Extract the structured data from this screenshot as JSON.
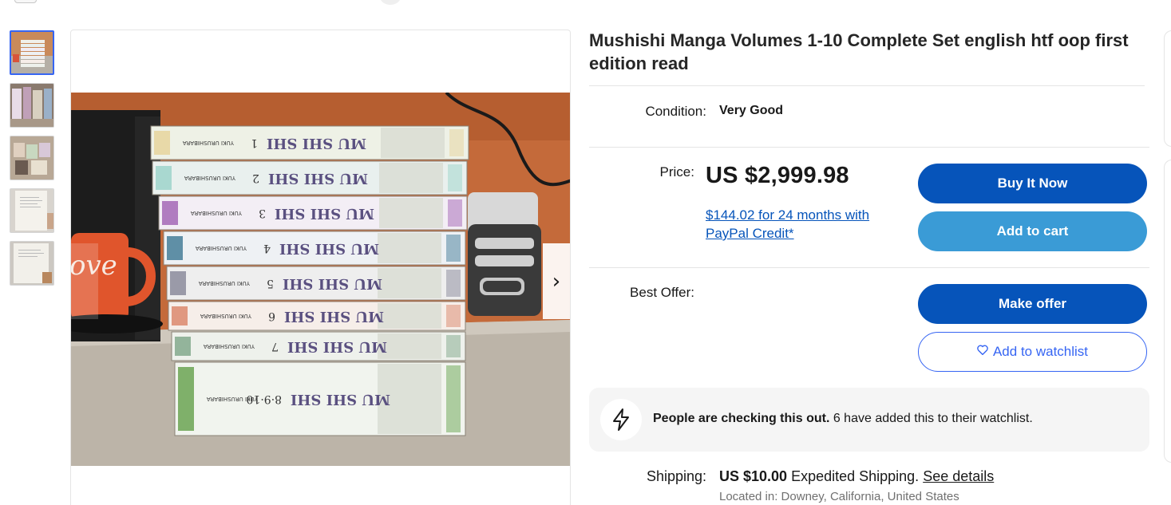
{
  "gallery": {
    "thumbnails": [
      {
        "name": "manga stack front"
      },
      {
        "name": "manga volumes spread"
      },
      {
        "name": "manga volumes on table"
      },
      {
        "name": "book interior page"
      },
      {
        "name": "book first page"
      }
    ],
    "photo_spines": [
      {
        "series": "MU SHI SHI",
        "volume": "1",
        "author": "YUKI URUSHIBARA",
        "color": "#eef1e6",
        "band": "#e8d9a8"
      },
      {
        "series": "MU SHI SHI",
        "volume": "2",
        "author": "YUKI URUSHIBARA",
        "color": "#e9f0ee",
        "band": "#a9d8d0"
      },
      {
        "series": "MU SHI SHI",
        "volume": "3",
        "author": "YUKI URUSHIBARA",
        "color": "#f3eef5",
        "band": "#b07cc0"
      },
      {
        "series": "MU SHI SHI",
        "volume": "4",
        "author": "YUKI URUSHIBARA",
        "color": "#eef1f4",
        "band": "#5f8fa6"
      },
      {
        "series": "MU SHI SHI",
        "volume": "5",
        "author": "YUKI URUSHIBARA",
        "color": "#eeeeee",
        "band": "#9a9aa8"
      },
      {
        "series": "MU SHI SHI",
        "volume": "6",
        "author": "YUKI URUSHIBARA",
        "color": "#f6eee9",
        "band": "#e09880"
      },
      {
        "series": "MU SHI SHI",
        "volume": "7",
        "author": "YUKI URUSHIBARA",
        "color": "#eef1ec",
        "band": "#93b49b"
      },
      {
        "series": "MU SHI SHI",
        "volume": "8·9·10",
        "author": "YUKI URUSHIBARA",
        "color": "#f1f4ee",
        "band": "#7fb06a"
      }
    ],
    "mug_text": "ove",
    "next_arrow": "›"
  },
  "listing": {
    "title": "Mushishi Manga Volumes 1-10 Complete Set english htf oop first edition read",
    "condition_label": "Condition:",
    "condition_value": "Very Good",
    "price_label": "Price:",
    "price": "US $2,999.98",
    "credit_offer": "$144.02 for 24 months with PayPal Credit*",
    "best_offer_label": "Best Offer:",
    "buttons": {
      "buy_now": "Buy It Now",
      "add_to_cart": "Add to cart",
      "make_offer": "Make offer",
      "watchlist": "Add to watchlist"
    },
    "signal": {
      "bold": "People are checking this out.",
      "rest": " 6 have added this to their watchlist."
    },
    "shipping_label": "Shipping:",
    "shipping_price": "US $10.00",
    "shipping_method": " Expedited Shipping. ",
    "shipping_link": "See details",
    "location": "Located in: Downey, California, United States"
  },
  "colors": {
    "primary": "#0654ba",
    "secondary": "#3a9bd6",
    "link": "#3665f3"
  }
}
